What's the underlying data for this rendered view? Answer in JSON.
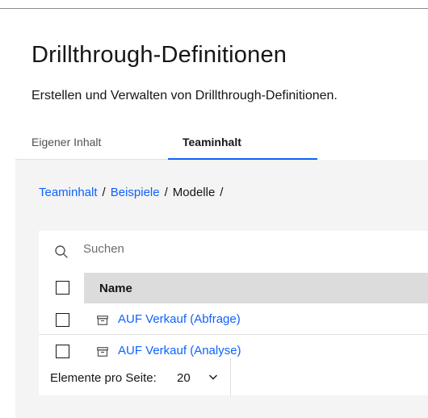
{
  "page": {
    "title": "Drillthrough-Definitionen",
    "subtitle": "Erstellen und Verwalten von Drillthrough-Definitionen."
  },
  "tabs": [
    {
      "label": "Eigener Inhalt",
      "selected": false
    },
    {
      "label": "Teaminhalt",
      "selected": true
    }
  ],
  "breadcrumb": {
    "items": [
      "Teaminhalt",
      "Beispiele",
      "Modelle"
    ],
    "separator": "/"
  },
  "search": {
    "placeholder": "Suchen",
    "value": "",
    "icon": "search-icon"
  },
  "table": {
    "column_name": "Name",
    "rows": [
      {
        "label": "AUF Verkauf (Abfrage)",
        "icon": "package-icon",
        "checked": false
      },
      {
        "label": "AUF Verkauf (Analyse)",
        "icon": "package-icon",
        "checked": false
      }
    ]
  },
  "pagination": {
    "per_page_label": "Elemente pro Seite:",
    "per_page_value": "20"
  },
  "colors": {
    "link": "#0f62fe",
    "tab_underline": "#0f62fe",
    "content_background": "#f4f4f4",
    "header_background": "#dcdcdc"
  }
}
